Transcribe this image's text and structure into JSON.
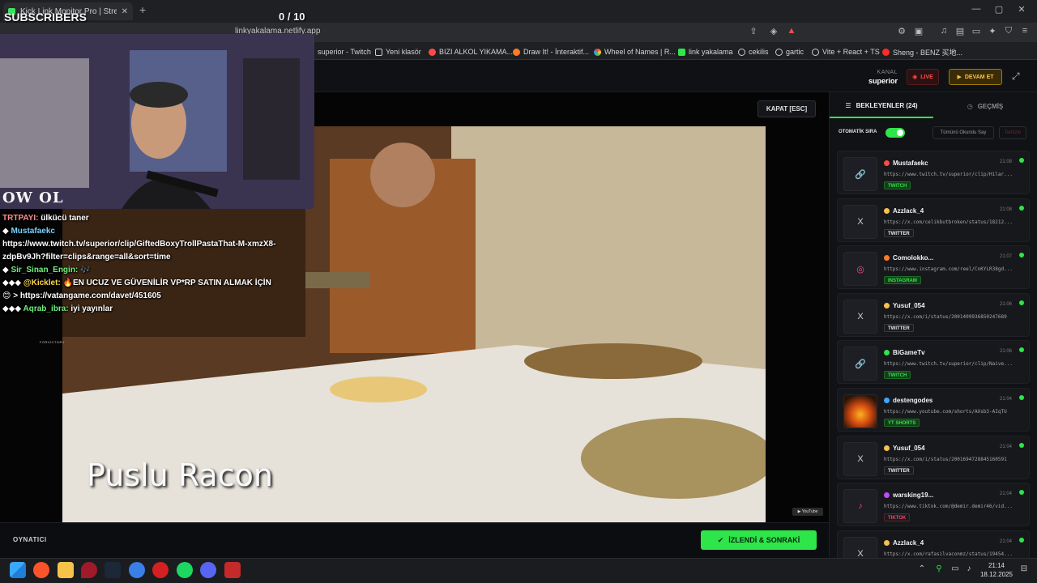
{
  "browser": {
    "tab_title": "Kick Link Monitor Pro | Stream",
    "url": "linkyakalama.netlify.app",
    "bookmarks": [
      "superior - Twitch",
      "Yeni klasör",
      "BIZI ALKOL YIKAMA...",
      "Draw It! - İnteraktif...",
      "Wheel of Names | R...",
      "link yakalama",
      "cekilis",
      "gartic",
      "Vite + React + TS",
      "Sheng - BENZ 买地..."
    ]
  },
  "header": {
    "kanal_label": "KANAL",
    "kanal_value": "superior",
    "live_label": "LIVE",
    "devam_label": "DEVAM ET"
  },
  "player": {
    "close_label": "KAPAT [ESC]",
    "caption": "Puslu Racon",
    "footer_label": "OYNATICI",
    "watched_label": "İZLENDİ & SONRAKİ"
  },
  "panel": {
    "tab_waiting": "BEKLEYENLER (24)",
    "tab_history": "GEÇMİŞ",
    "auto_queue_label": "OTOMATİK SIRA",
    "mark_all_label": "Tümünü Okundu Say",
    "clear_label": "Temizle",
    "items": [
      {
        "user": "Mustafaekc",
        "time": "21:08",
        "url": "https://www.twitch.tv/superior/clip/Hilar...",
        "badge": "TWITCH",
        "icon": "link-icon",
        "dot": "#ff4a4a"
      },
      {
        "user": "Azzlack_4",
        "time": "21:08",
        "url": "https://x.com/celikbutbroken/status/18212...",
        "badge": "TWITTER",
        "icon": "x-icon",
        "dot": "#f6c24a"
      },
      {
        "user": "Comolokko...",
        "time": "21:07",
        "url": "https://www.instagram.com/reel/CnKYLR38gd...",
        "badge": "INSTAGRAM",
        "icon": "instagram-icon",
        "dot": "#ff7a2a"
      },
      {
        "user": "Yusuf_054",
        "time": "21:06",
        "url": "https://x.com/i/status/2001409936850247689",
        "badge": "TWITTER",
        "icon": "x-icon",
        "dot": "#f6c24a"
      },
      {
        "user": "BiGameTv",
        "time": "21:06",
        "url": "https://www.twitch.tv/superior/clip/Naive...",
        "badge": "TWITCH",
        "icon": "link-icon",
        "dot": "#2ee54a"
      },
      {
        "user": "destengodes",
        "time": "21:04",
        "url": "https://www.youtube.com/shorts/AXsb3-AIqTU",
        "badge": "YT SHORTS",
        "icon": "fire-thumbnail",
        "dot": "#3aa8ff"
      },
      {
        "user": "Yusuf_054",
        "time": "21:04",
        "url": "https://x.com/i/status/2001694728845160591",
        "badge": "TWITTER",
        "icon": "x-icon",
        "dot": "#f6c24a"
      },
      {
        "user": "warsking19...",
        "time": "21:04",
        "url": "https://www.tiktok.com/@demir.demir46/vid...",
        "badge": "TIKTOK",
        "icon": "tiktok-icon",
        "dot": "#c04aff"
      },
      {
        "user": "Azzlack_4",
        "time": "21:04",
        "url": "https://x.com/rafasilvaconmz/status/19454...",
        "badge": "TWITTER",
        "icon": "x-icon",
        "dot": "#f6c24a"
      }
    ]
  },
  "overlay": {
    "subs_title": "SUBSCRIBERS",
    "subs_count": "0 / 10",
    "logo": "OW OL",
    "sponsor": "FORVICTORY",
    "chat": [
      {
        "user": "TRTPAYI:",
        "msg": " ülkücü taner"
      },
      {
        "user": "Mustafaekc",
        "msg": ""
      },
      {
        "user": "",
        "msg": "https://www.twitch.tv/superior/clip/GiftedBoxyTrollPastaThat-M-xmzX8-zdpBv9Jh?filter=clips&range=all&sort=time"
      },
      {
        "user": "Sir_Sinan_Engin:",
        "msg": " 🎶"
      },
      {
        "user": "@Kicklet:",
        "msg": " 🔥EN UCUZ VE GÜVENİLİR VP*RP SATIN ALMAK İÇİN"
      },
      {
        "user": "",
        "msg": "😊 > https://vatangame.com/davet/451605"
      },
      {
        "user": "Aqrab_ibra:",
        "msg": " iyi yayınlar"
      }
    ]
  },
  "taskbar": {
    "time": "21:14",
    "date": "18.12.2025"
  },
  "colors": {
    "accent": "#2ee54a",
    "live": "#ff4a4a",
    "warn": "#f6c24a"
  }
}
